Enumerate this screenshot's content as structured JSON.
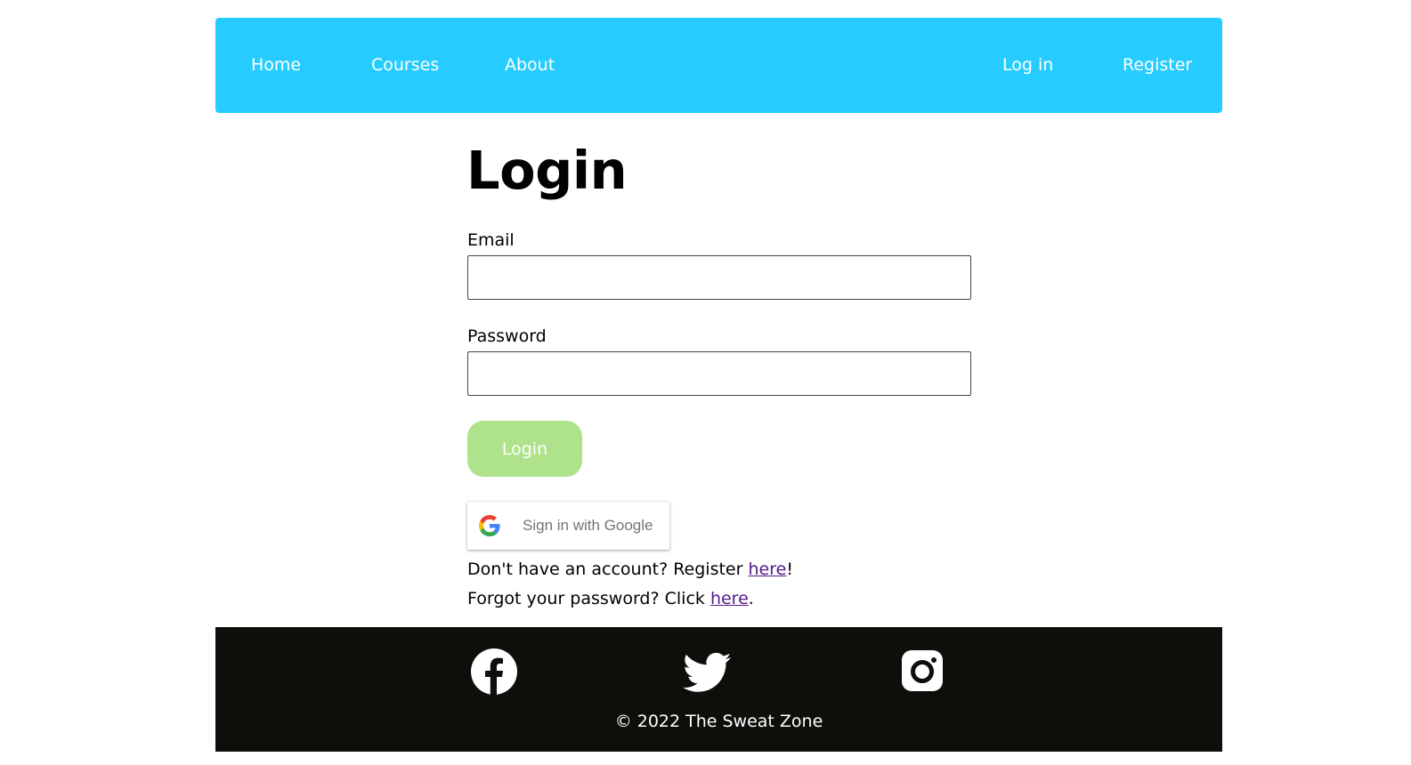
{
  "nav": {
    "home": "Home",
    "courses": "Courses",
    "about": "About",
    "login": "Log in",
    "register": "Register"
  },
  "form": {
    "title": "Login",
    "email_label": "Email",
    "email_value": "",
    "password_label": "Password",
    "password_value": "",
    "submit_label": "Login",
    "google_label": "Sign in with Google"
  },
  "help": {
    "register_prefix": "Don't have an account? Register ",
    "register_link": "here",
    "register_suffix": "!",
    "forgot_prefix": "Forgot your password? Click ",
    "forgot_link": "here",
    "forgot_suffix": "."
  },
  "footer": {
    "social_icons": [
      "facebook-icon",
      "twitter-icon",
      "instagram-icon"
    ],
    "copyright": "© 2022 The Sweat Zone"
  },
  "colors": {
    "navbar": "#26ccff",
    "login_button": "#aee38b",
    "footer": "#0d0f0b",
    "link": "#551a8b"
  }
}
